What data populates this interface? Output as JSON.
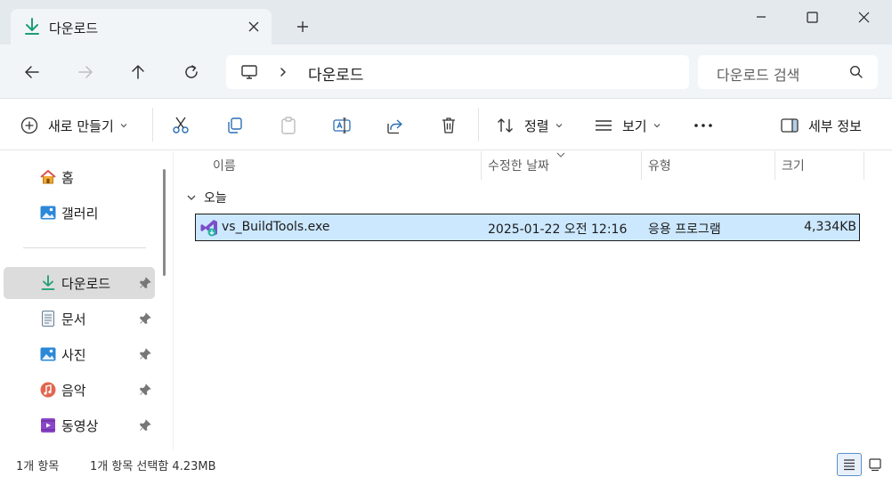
{
  "window": {
    "tab_title": "다운로드",
    "controls": [
      "minimize-icon",
      "maximize-icon",
      "close-icon"
    ]
  },
  "navigation": {
    "breadcrumb": [
      "다운로드"
    ],
    "search_placeholder": "다운로드 검색"
  },
  "toolbar": {
    "new_label": "새로 만들기",
    "sort_label": "정렬",
    "view_label": "보기",
    "details_label": "세부 정보"
  },
  "sidebar": {
    "items": [
      {
        "label": "홈",
        "icon": "home-icon",
        "pinned": false
      },
      {
        "label": "갤러리",
        "icon": "gallery-icon",
        "pinned": false
      },
      {
        "label": "다운로드",
        "icon": "download-icon",
        "pinned": true
      },
      {
        "label": "문서",
        "icon": "documents-icon",
        "pinned": true
      },
      {
        "label": "사진",
        "icon": "pictures-icon",
        "pinned": true
      },
      {
        "label": "음악",
        "icon": "music-icon",
        "pinned": true
      },
      {
        "label": "동영상",
        "icon": "videos-icon",
        "pinned": true
      }
    ]
  },
  "file_list": {
    "columns": [
      "이름",
      "수정한 날짜",
      "유형",
      "크기"
    ],
    "groups": [
      {
        "label": "오늘",
        "rows": [
          {
            "name": "vs_BuildTools.exe",
            "modified": "2025-01-22 오전 12:16",
            "type": "응용 프로그램",
            "size": "4,334KB",
            "selected": true
          }
        ]
      }
    ]
  },
  "status": {
    "item_count": "1개 항목",
    "selection": "1개 항목 선택함 4.23MB"
  },
  "colors": {
    "accent_download": "#1a9e76",
    "selection_bg": "#cce8ff",
    "titlebar_bg": "#e4e9ee"
  }
}
